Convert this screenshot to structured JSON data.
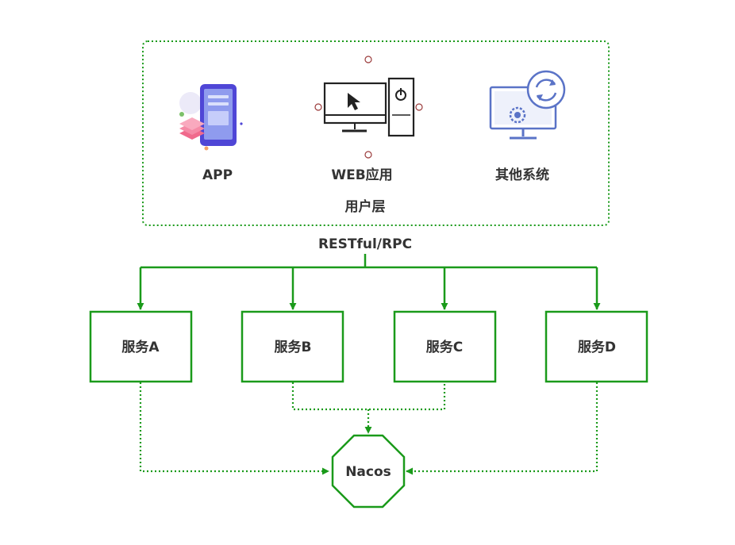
{
  "colors": {
    "green": "#1a9a1a",
    "text": "#333333",
    "icon_blue": "#5a73c7",
    "app_purple": "#4f46d6",
    "app_pink": "#f06a8c",
    "handle_red": "#9b3b3b",
    "monitor_dark": "#222222"
  },
  "user_layer": {
    "label": "用户层",
    "clients": [
      {
        "label": "APP",
        "icon": "mobile-app-icon"
      },
      {
        "label": "WEB应用",
        "icon": "desktop-computer-icon"
      },
      {
        "label": "其他系统",
        "icon": "system-sync-icon"
      }
    ]
  },
  "connector_label": "RESTful/RPC",
  "services": [
    {
      "label": "服务A"
    },
    {
      "label": "服务B"
    },
    {
      "label": "服务C"
    },
    {
      "label": "服务D"
    }
  ],
  "registry": {
    "label": "Nacos"
  }
}
